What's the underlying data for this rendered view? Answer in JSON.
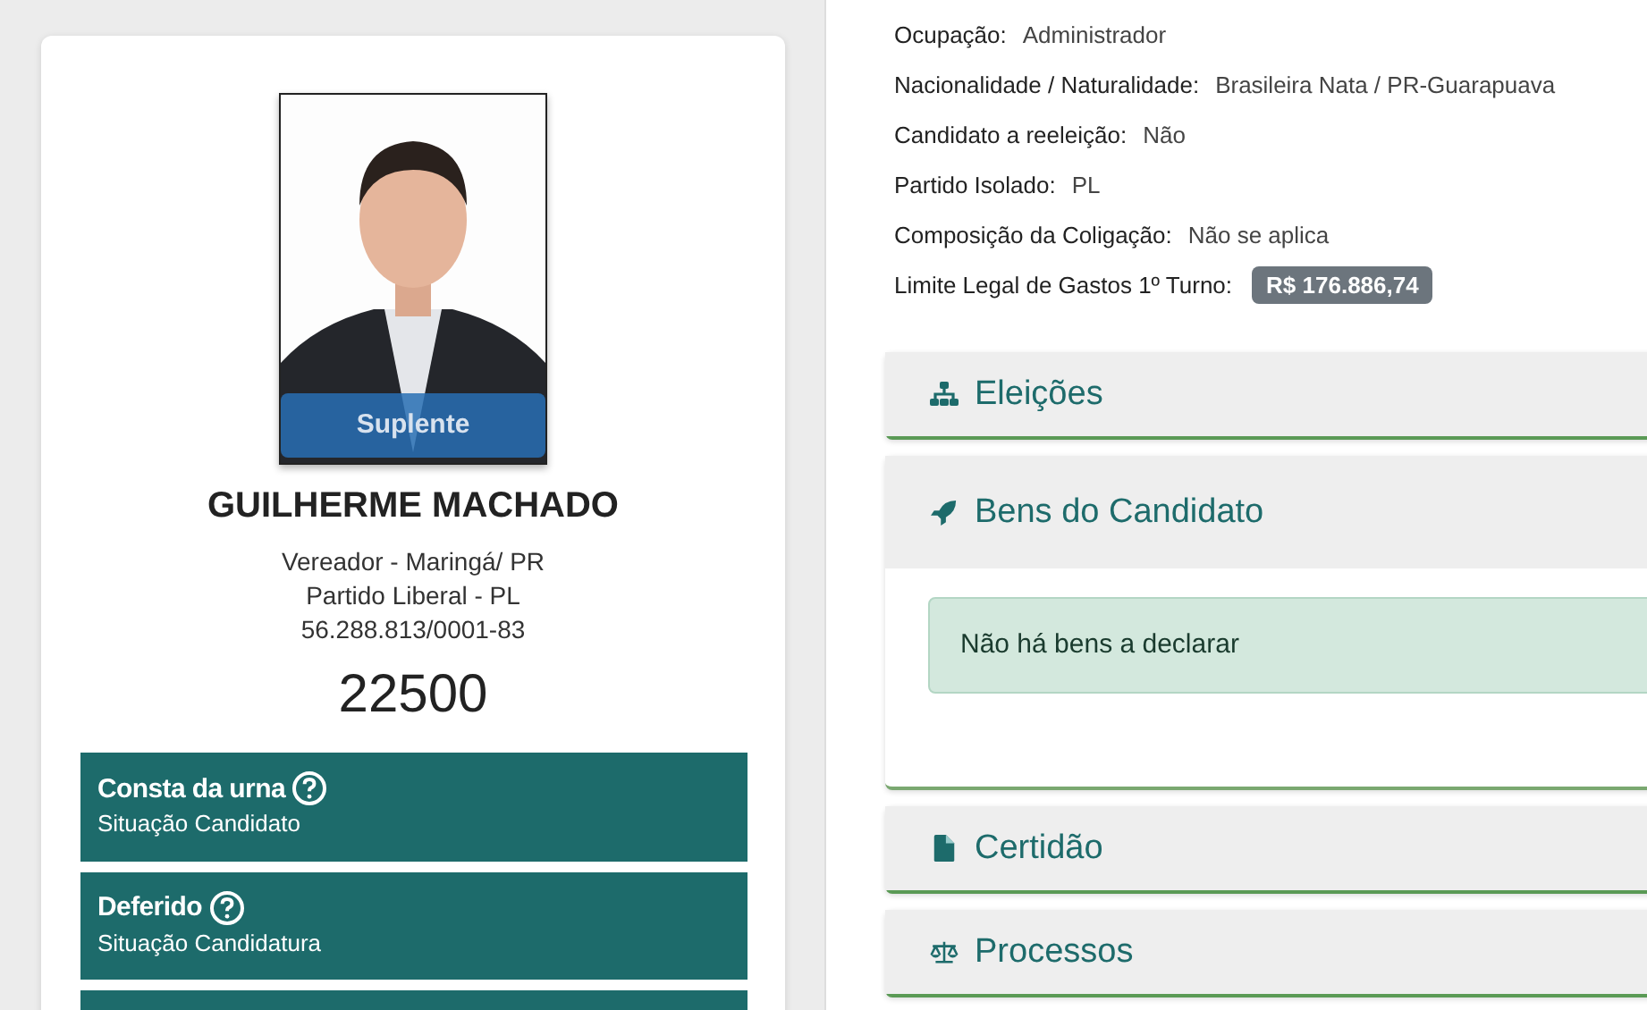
{
  "candidate": {
    "photo_badge": "Suplente",
    "name": "GUILHERME MACHADO",
    "lines": [
      "Vereador - Maringá/ PR",
      "Partido Liberal - PL",
      "56.288.813/0001-83"
    ],
    "number": "22500"
  },
  "statuses": [
    {
      "title": "Consta da urna",
      "subtitle": "Situação Candidato"
    },
    {
      "title": "Deferido",
      "subtitle": "Situação Candidatura"
    }
  ],
  "details": [
    {
      "label": "Ocupação:",
      "value": "Administrador",
      "kind": "text"
    },
    {
      "label": "Nacionalidade / Naturalidade:",
      "value": "Brasileira Nata / PR-Guarapuava",
      "kind": "text"
    },
    {
      "label": "Candidato a reeleição:",
      "value": "Não",
      "kind": "text"
    },
    {
      "label": "Partido Isolado:",
      "value": "PL",
      "kind": "text"
    },
    {
      "label": "Composição da Coligação:",
      "value": "Não se aplica",
      "kind": "text"
    },
    {
      "label": "Limite Legal de Gastos 1º Turno:",
      "value": "R$ 176.886,74",
      "kind": "badge"
    }
  ],
  "sections": [
    {
      "title": "Eleições",
      "expanded": false
    },
    {
      "title": "Bens do Candidato",
      "expanded": true,
      "message": "Não há bens a declarar"
    },
    {
      "title": "Certidão",
      "expanded": false
    },
    {
      "title": "Processos",
      "expanded": false
    }
  ]
}
